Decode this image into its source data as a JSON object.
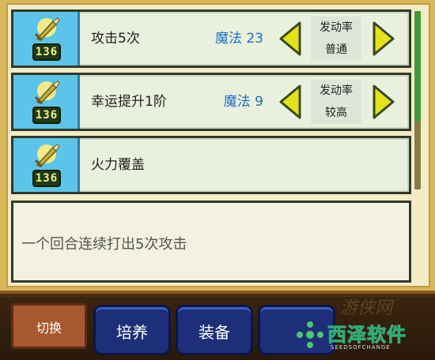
{
  "skills": [
    {
      "name": "攻击5次",
      "cost": "魔法 23",
      "badge": "136",
      "rate_label": "发动率",
      "rate_value": "普通"
    },
    {
      "name": "幸运提升1阶",
      "cost": "魔法 9",
      "badge": "136",
      "rate_label": "发动率",
      "rate_value": "较高"
    },
    {
      "name": "火力覆盖",
      "badge": "136"
    }
  ],
  "description": "一个回合连续打出5次攻击",
  "buttons": {
    "switch": "切换",
    "train": "培养",
    "equip": "装备"
  },
  "watermark": {
    "title": "西泽软件",
    "subtitle": "SEEDSOFCHANGE",
    "brush_text": "游侠网"
  },
  "icons": {
    "skill": "sword-wheat-icon",
    "left_arrow": "arrow-left-icon",
    "right_arrow": "arrow-right-icon"
  },
  "colors": {
    "accent_yellow": "#e4e21a",
    "cost_blue": "#1f6fc4",
    "icon_bg": "#5cc4e8"
  }
}
